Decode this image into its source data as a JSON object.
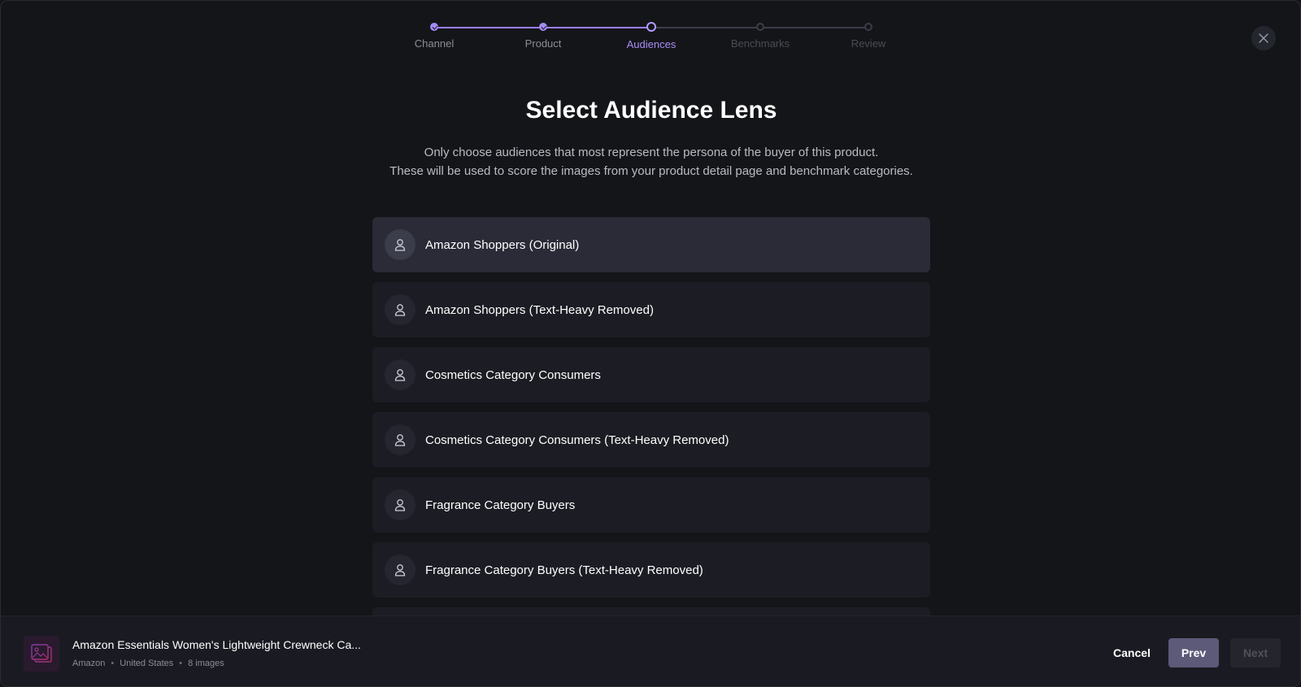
{
  "stepper": {
    "steps": [
      {
        "label": "Channel",
        "state": "done"
      },
      {
        "label": "Product",
        "state": "done"
      },
      {
        "label": "Audiences",
        "state": "current"
      },
      {
        "label": "Benchmarks",
        "state": "upcoming"
      },
      {
        "label": "Review",
        "state": "upcoming"
      }
    ]
  },
  "page": {
    "title": "Select Audience Lens",
    "subtitle_line1": "Only choose audiences that most represent the persona of the buyer of this product.",
    "subtitle_line2": "These will be used to score the images from your product detail page and benchmark categories."
  },
  "audiences": [
    {
      "label": "Amazon Shoppers (Original)",
      "selected": true,
      "icon": "user-icon"
    },
    {
      "label": "Amazon Shoppers (Text-Heavy Removed)",
      "selected": false,
      "icon": "user-icon"
    },
    {
      "label": "Cosmetics Category Consumers",
      "selected": false,
      "icon": "user-icon"
    },
    {
      "label": "Cosmetics Category Consumers (Text-Heavy Removed)",
      "selected": false,
      "icon": "user-icon"
    },
    {
      "label": "Fragrance Category Buyers",
      "selected": false,
      "icon": "user-icon"
    },
    {
      "label": "Fragrance Category Buyers (Text-Heavy Removed)",
      "selected": false,
      "icon": "user-icon"
    }
  ],
  "footer": {
    "product_name": "Amazon Essentials Women's Lightweight Crewneck Ca...",
    "channel": "Amazon",
    "country": "United States",
    "image_count": "8 images",
    "cancel_label": "Cancel",
    "prev_label": "Prev",
    "next_label": "Next"
  },
  "colors": {
    "accent": "#a58cf5",
    "background": "#141519",
    "selected_item": "#2a2b37"
  }
}
